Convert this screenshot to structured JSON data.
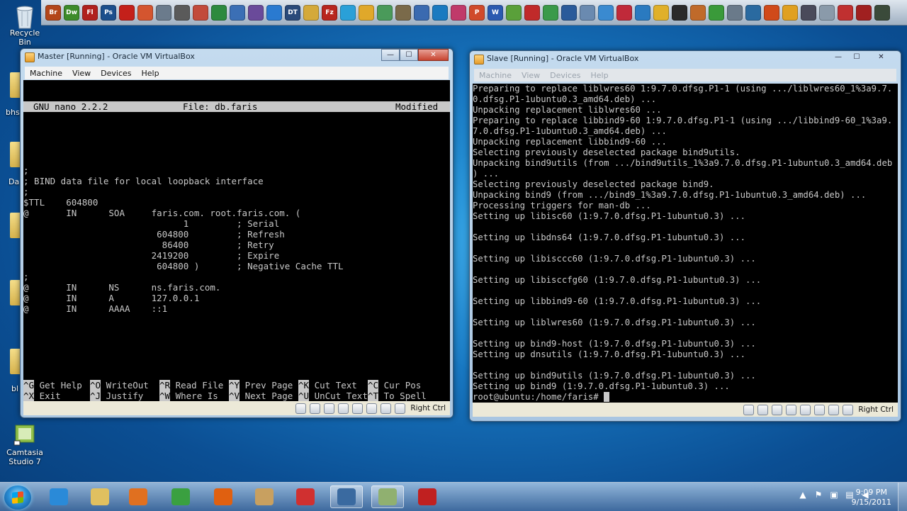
{
  "desktop": {
    "icons": [
      {
        "label": "Recycle Bin",
        "icon": "recycle-bin-icon"
      },
      {
        "label": "Camtasia Studio 7",
        "icon": "camtasia-icon"
      }
    ],
    "partial_labels": [
      "bhs",
      "Da",
      "bl"
    ]
  },
  "dock": {
    "icons": [
      {
        "name": "bridge-icon",
        "text": "Br",
        "color": "#b3461a"
      },
      {
        "name": "dreamweaver-icon",
        "text": "Dw",
        "color": "#3d8b2a"
      },
      {
        "name": "flash-icon",
        "text": "Fl",
        "color": "#b0201d"
      },
      {
        "name": "photoshop-icon",
        "text": "Ps",
        "color": "#1c4f8c"
      },
      {
        "name": "acrobat-icon",
        "text": "",
        "color": "#c4201a"
      },
      {
        "name": "app-icon",
        "text": "",
        "color": "#d4552f"
      },
      {
        "name": "tools-icon",
        "text": "",
        "color": "#6b7b8c"
      },
      {
        "name": "disk-icon",
        "text": "",
        "color": "#5a5a5a"
      },
      {
        "name": "app-icon",
        "text": "",
        "color": "#c24a3b"
      },
      {
        "name": "app-icon",
        "text": "",
        "color": "#2d8a3e"
      },
      {
        "name": "app-icon",
        "text": "",
        "color": "#3b6fb5"
      },
      {
        "name": "cpuz-icon",
        "text": "",
        "color": "#6a4a9a"
      },
      {
        "name": "app-icon",
        "text": "",
        "color": "#2a7ad0"
      },
      {
        "name": "app-icon",
        "text": "DT",
        "color": "#2a4a7a"
      },
      {
        "name": "folder-icon",
        "text": "",
        "color": "#d4a93a"
      },
      {
        "name": "filezilla-icon",
        "text": "Fz",
        "color": "#b8261e"
      },
      {
        "name": "app-icon",
        "text": "",
        "color": "#2aa0d8"
      },
      {
        "name": "chrome-icon",
        "text": "",
        "color": "#e0a82a"
      },
      {
        "name": "app-icon",
        "text": "",
        "color": "#4a9a5a"
      },
      {
        "name": "app-icon",
        "text": "",
        "color": "#7a6a4a"
      },
      {
        "name": "app-icon",
        "text": "",
        "color": "#3a6ab0"
      },
      {
        "name": "app-icon",
        "text": "",
        "color": "#1a7ac0"
      },
      {
        "name": "app-icon",
        "text": "",
        "color": "#c03a6a"
      },
      {
        "name": "app-icon",
        "text": "P",
        "color": "#d04a2a"
      },
      {
        "name": "word-icon",
        "text": "W",
        "color": "#2a5ab0"
      },
      {
        "name": "app-icon",
        "text": "",
        "color": "#5aa03a"
      },
      {
        "name": "app-icon",
        "text": "",
        "color": "#c02a2a"
      },
      {
        "name": "app-icon",
        "text": "",
        "color": "#3a9a4a"
      },
      {
        "name": "virtualbox-icon",
        "text": "",
        "color": "#2a5a9a"
      },
      {
        "name": "app-icon",
        "text": "",
        "color": "#6a8ab0"
      },
      {
        "name": "app-icon",
        "text": "",
        "color": "#3a8ad0"
      },
      {
        "name": "app-icon",
        "text": "",
        "color": "#c02a3a"
      },
      {
        "name": "app-icon",
        "text": "",
        "color": "#2a7ac0"
      },
      {
        "name": "app-icon",
        "text": "",
        "color": "#e0b02a"
      },
      {
        "name": "app-icon",
        "text": "",
        "color": "#2a2a2a"
      },
      {
        "name": "app-icon",
        "text": "",
        "color": "#c06a2a"
      },
      {
        "name": "app-icon",
        "text": "",
        "color": "#3a9a3a"
      },
      {
        "name": "app-icon",
        "text": "",
        "color": "#6a7a8a"
      },
      {
        "name": "app-icon",
        "text": "",
        "color": "#2a6aa0"
      },
      {
        "name": "app-icon",
        "text": "",
        "color": "#d04a1a"
      },
      {
        "name": "app-icon",
        "text": "",
        "color": "#e0a020"
      },
      {
        "name": "app-icon",
        "text": "",
        "color": "#4a4a5a"
      },
      {
        "name": "app-icon",
        "text": "",
        "color": "#8a9aaa"
      },
      {
        "name": "app-icon",
        "text": "",
        "color": "#c03030"
      },
      {
        "name": "app-icon",
        "text": "",
        "color": "#a02020"
      },
      {
        "name": "app-icon",
        "text": "",
        "color": "#3a4a3a"
      }
    ]
  },
  "master_window": {
    "title": "Master [Running] - Oracle VM VirtualBox",
    "menu": [
      "Machine",
      "View",
      "Devices",
      "Help"
    ],
    "buttons": {
      "minimize": "—",
      "maximize": "☐",
      "close": "✕"
    },
    "nano": {
      "version": "GNU nano 2.2.2",
      "file": "File: db.faris",
      "status": "Modified",
      "lines": [
        ";",
        "; BIND data file for local loopback interface",
        ";",
        "$TTL    604800",
        "@       IN      SOA     faris.com. root.faris.com. (",
        "                              1         ; Serial",
        "                         604800         ; Refresh",
        "                          86400         ; Retry",
        "                        2419200         ; Expire",
        "                         604800 )       ; Negative Cache TTL",
        ";",
        "@       IN      NS      ns.faris.com.",
        "@       IN      A       127.0.0.1",
        "@       IN      AAAA    ::1"
      ],
      "shortcuts_row1": [
        {
          "key": "^G",
          "label": "Get Help"
        },
        {
          "key": "^O",
          "label": "WriteOut"
        },
        {
          "key": "^R",
          "label": "Read File"
        },
        {
          "key": "^Y",
          "label": "Prev Page"
        },
        {
          "key": "^K",
          "label": "Cut Text"
        },
        {
          "key": "^C",
          "label": "Cur Pos"
        }
      ],
      "shortcuts_row2": [
        {
          "key": "^X",
          "label": "Exit"
        },
        {
          "key": "^J",
          "label": "Justify"
        },
        {
          "key": "^W",
          "label": "Where Is"
        },
        {
          "key": "^V",
          "label": "Next Page"
        },
        {
          "key": "^U",
          "label": "UnCut Text"
        },
        {
          "key": "^T",
          "label": "To Spell"
        }
      ]
    },
    "host_key": "Right Ctrl"
  },
  "slave_window": {
    "title": "Slave [Running] - Oracle VM VirtualBox",
    "menu": [
      "Machine",
      "View",
      "Devices",
      "Help"
    ],
    "buttons": {
      "minimize": "—",
      "maximize": "☐",
      "close": "✕"
    },
    "lines": [
      "Preparing to replace liblwres60 1:9.7.0.dfsg.P1-1 (using .../liblwres60_1%3a9.7.",
      "0.dfsg.P1-1ubuntu0.3_amd64.deb) ...",
      "Unpacking replacement liblwres60 ...",
      "Preparing to replace libbind9-60 1:9.7.0.dfsg.P1-1 (using .../libbind9-60_1%3a9.",
      "7.0.dfsg.P1-1ubuntu0.3_amd64.deb) ...",
      "Unpacking replacement libbind9-60 ...",
      "Selecting previously deselected package bind9utils.",
      "Unpacking bind9utils (from .../bind9utils_1%3a9.7.0.dfsg.P1-1ubuntu0.3_amd64.deb",
      ") ...",
      "Selecting previously deselected package bind9.",
      "Unpacking bind9 (from .../bind9_1%3a9.7.0.dfsg.P1-1ubuntu0.3_amd64.deb) ...",
      "Processing triggers for man-db ...",
      "Setting up libisc60 (1:9.7.0.dfsg.P1-1ubuntu0.3) ...",
      "",
      "Setting up libdns64 (1:9.7.0.dfsg.P1-1ubuntu0.3) ...",
      "",
      "Setting up libisccc60 (1:9.7.0.dfsg.P1-1ubuntu0.3) ...",
      "",
      "Setting up libisccfg60 (1:9.7.0.dfsg.P1-1ubuntu0.3) ...",
      "",
      "Setting up libbind9-60 (1:9.7.0.dfsg.P1-1ubuntu0.3) ...",
      "",
      "Setting up liblwres60 (1:9.7.0.dfsg.P1-1ubuntu0.3) ...",
      "",
      "Setting up bind9-host (1:9.7.0.dfsg.P1-1ubuntu0.3) ...",
      "Setting up dnsutils (1:9.7.0.dfsg.P1-1ubuntu0.3) ...",
      "",
      "Setting up bind9utils (1:9.7.0.dfsg.P1-1ubuntu0.3) ...",
      "Setting up bind9 (1:9.7.0.dfsg.P1-1ubuntu0.3) ...",
      "root@ubuntu:/home/faris# "
    ],
    "host_key": "Right Ctrl"
  },
  "taskbar": {
    "apps": [
      {
        "name": "internet-explorer-icon",
        "color": "#2a8ad8",
        "active": false
      },
      {
        "name": "file-explorer-icon",
        "color": "#e0c060",
        "active": false
      },
      {
        "name": "media-player-icon",
        "color": "#e07020",
        "active": false
      },
      {
        "name": "app-green-icon",
        "color": "#3aa040",
        "active": false
      },
      {
        "name": "firefox-icon",
        "color": "#e06010",
        "active": false
      },
      {
        "name": "paint-icon",
        "color": "#c8a060",
        "active": false
      },
      {
        "name": "book-icon",
        "color": "#d03030",
        "active": false
      },
      {
        "name": "virtualbox-icon",
        "color": "#3a6aa0",
        "active": true
      },
      {
        "name": "map-icon",
        "color": "#90b070",
        "active": true
      },
      {
        "name": "camtasia-recorder-icon",
        "color": "#c02020",
        "active": false
      }
    ],
    "time": "9:09 PM",
    "date": "9/15/2011"
  }
}
